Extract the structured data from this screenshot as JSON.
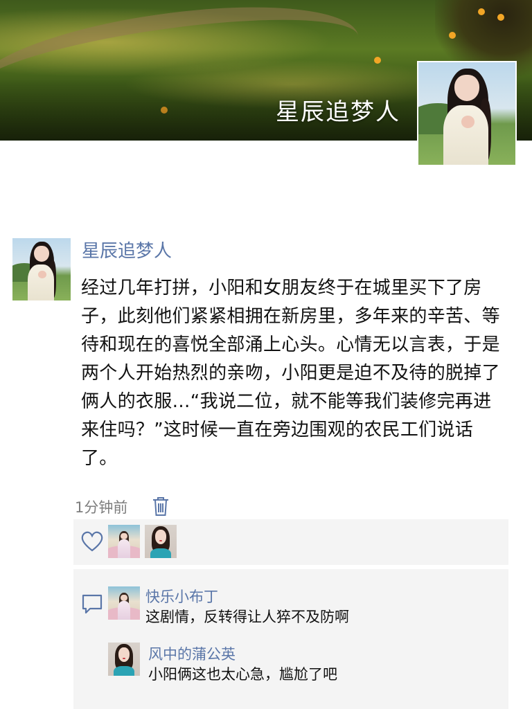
{
  "profile": {
    "cover_name": "星辰追梦人"
  },
  "post": {
    "author": "星辰追梦人",
    "text": "经过几年打拼，小阳和女朋友终于在城里买下了房子，此刻他们紧紧相拥在新房里，多年来的辛苦、等待和现在的喜悦全部涌上心头。心情无以言表，于是两个人开始热烈的亲吻，小阳更是迫不及待的脱掉了俩人的衣服…“我说二位，就不能等我们装修完再进来住吗？”这时候一直在旁边围观的农民工们说话了。",
    "time": "1分钟前"
  },
  "icons": {
    "trash": "trash-icon",
    "heart": "heart-icon",
    "comment": "comment-icon"
  },
  "comments": [
    {
      "name": "快乐小布丁",
      "text": "这剧情，反转得让人猝不及防啊"
    },
    {
      "name": "风中的蒲公英",
      "text": "小阳俩这也太心急，尴尬了吧"
    }
  ],
  "colors": {
    "link_blue": "#5a76a8",
    "panel_gray": "#f4f4f4",
    "meta_gray": "#7d7d7d"
  }
}
